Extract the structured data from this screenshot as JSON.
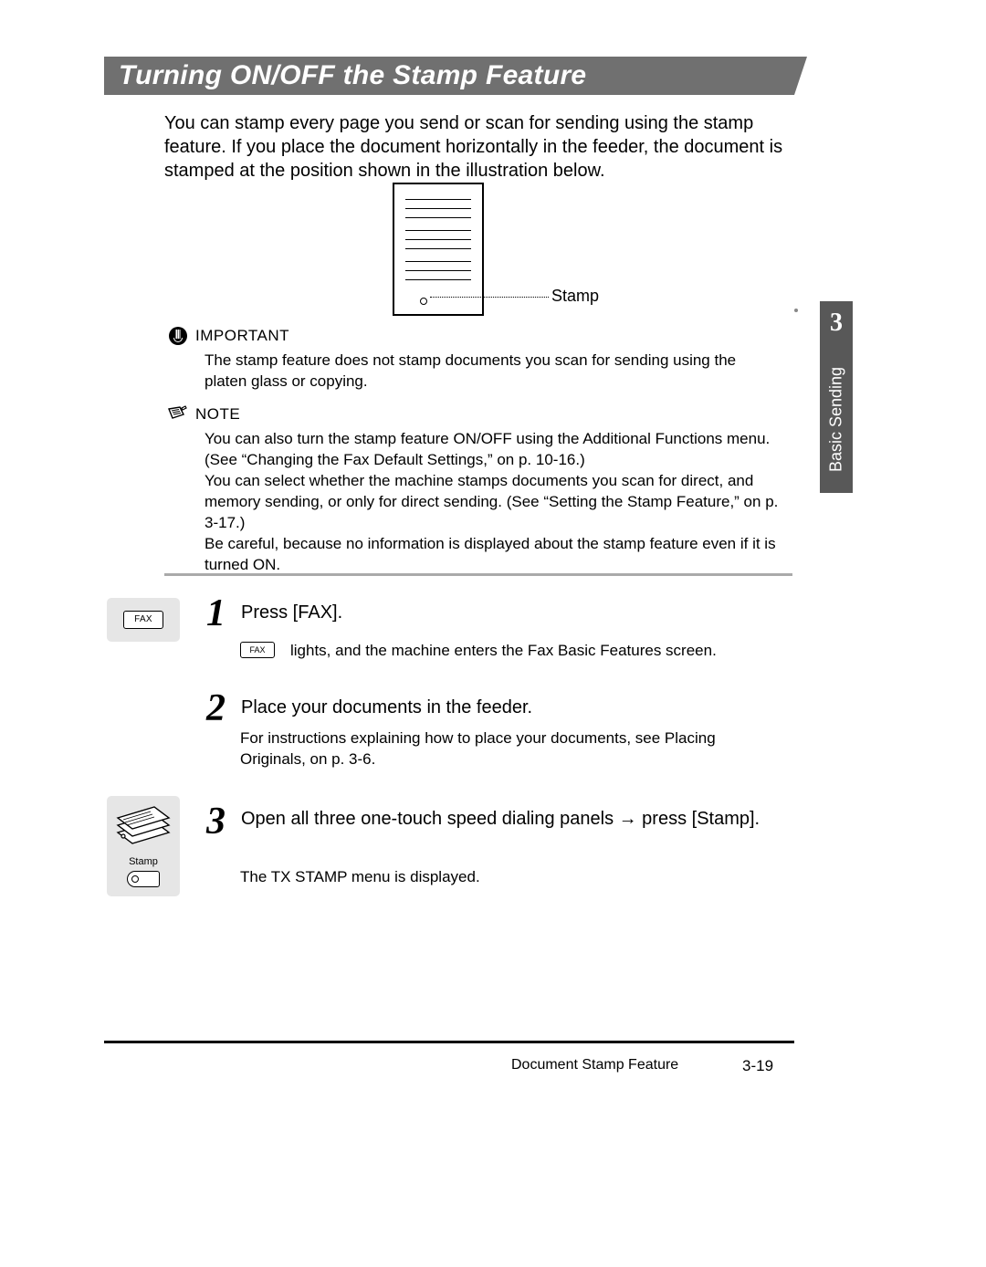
{
  "section_title": "Turning ON/OFF the Stamp Feature",
  "intro": "You can stamp every page you send or scan for sending using the stamp feature. If you place the document horizontally in the feeder, the document is stamped at the position shown in the illustration below.",
  "illustration": {
    "pointer_label": "Stamp"
  },
  "side_tab": {
    "chapter_number": "3",
    "chapter_title": "Basic Sending"
  },
  "important": {
    "label": "IMPORTANT",
    "text": "The stamp feature does not stamp documents you scan for sending using the platen glass or copying."
  },
  "note": {
    "label": "NOTE",
    "p1": "You can also turn the stamp feature ON/OFF using the Additional Functions menu. (See “Changing the Fax Default Settings,” on p. 10-16.)",
    "p2": "You can select whether the machine stamps documents you scan for direct, and memory sending, or only for direct sending. (See “Setting the Stamp Feature,” on p. 3-17.)",
    "p3": "Be careful, because no information is displayed about the stamp feature even if it is turned ON."
  },
  "fax_key": {
    "label": "FAX",
    "inline_label": "FAX"
  },
  "steps": {
    "s1": {
      "num": "1",
      "head": "Press [FAX].",
      "body": "lights, and the machine enters the Fax Basic Features screen."
    },
    "s2": {
      "num": "2",
      "head": "Place your documents in the feeder.",
      "body": "For instructions explaining how to place your documents, see  Placing Originals,  on p. 3-6."
    },
    "s3": {
      "num": "3",
      "head_a": "Open all three one-touch speed dialing panels ",
      "head_b": " press [Stamp].",
      "arrow": "→",
      "body": "The TX STAMP menu is displayed."
    }
  },
  "stamp_panel": {
    "label": "Stamp"
  },
  "footer": {
    "title": "Document Stamp Feature",
    "page": "3-19"
  }
}
